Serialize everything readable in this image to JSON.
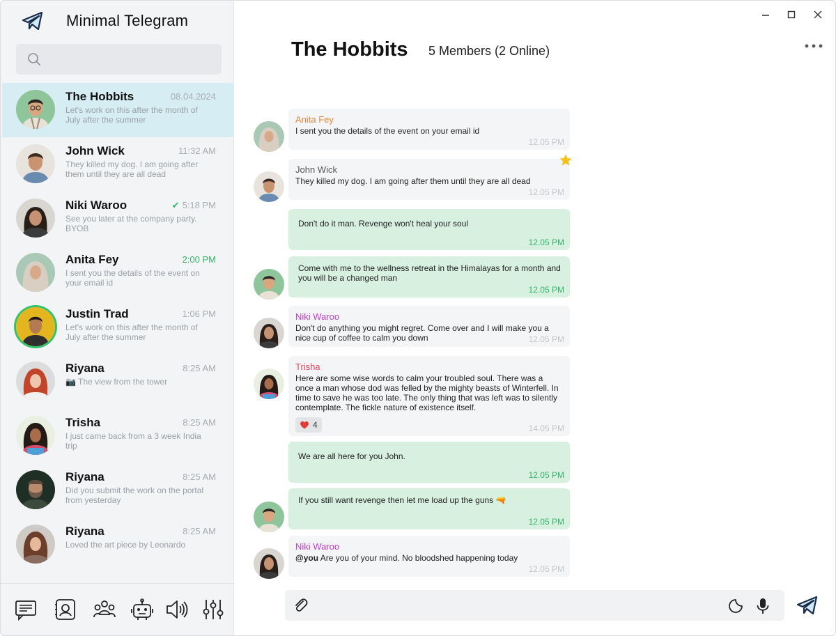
{
  "app": {
    "title": "Minimal Telegram"
  },
  "search": {
    "placeholder": ""
  },
  "chats": [
    {
      "name": "The Hobbits",
      "time": "08.04.2024",
      "preview": "Let's work on this after the month of July after the summer",
      "active": true
    },
    {
      "name": "John Wick",
      "time": "11:32 AM",
      "preview": "They killed my dog. I am going after them until they are all dead"
    },
    {
      "name": "Niki Waroo",
      "time": "5:18 PM",
      "preview": "See you later at the company party. BYOB",
      "read_tick": "✔"
    },
    {
      "name": "Anita Fey",
      "time": "2:00 PM",
      "preview": "I sent you the details of the event on your email id",
      "time_highlight": true
    },
    {
      "name": "Justin Trad",
      "time": "1:06 PM",
      "preview": "Let's work on this after the month of July after the summer",
      "online_ring": true
    },
    {
      "name": "Riyana",
      "time": "8:25 AM",
      "preview": "📷 The view from the tower"
    },
    {
      "name": "Trisha",
      "time": "8:25 AM",
      "preview": "I just came back from a 3 week India trip"
    },
    {
      "name": "Riyana",
      "time": "8:25 AM",
      "preview": "Did you submit the work on the portal from yesterday"
    },
    {
      "name": "Riyana",
      "time": "8:25 AM",
      "preview": "Loved the art piece by Leonardo"
    }
  ],
  "bottom_nav": [
    {
      "icon": "chats-icon"
    },
    {
      "icon": "contacts-icon"
    },
    {
      "icon": "groups-icon"
    },
    {
      "icon": "bot-icon"
    },
    {
      "icon": "speaker-icon"
    },
    {
      "icon": "settings-sliders-icon"
    }
  ],
  "header": {
    "title": "The Hobbits",
    "members": "5 Members (2 Online)"
  },
  "messages": [
    {
      "sender": "Anita Fey",
      "sender_color": "#e8873a",
      "text": "I sent you the details of the event on your email id",
      "time": "12.05 PM",
      "direction": "in"
    },
    {
      "sender": "John Wick",
      "sender_color": "#555555",
      "text": "They killed my dog. I am going after them until they are all dead",
      "time": "12.05 PM",
      "direction": "in",
      "starred": true
    },
    {
      "text": "Don't do it man. Revenge won't heal your soul",
      "time": "12.05 PM",
      "direction": "out"
    },
    {
      "text": "Come with me to the wellness retreat in the Himalayas for a month and you will be a changed man",
      "time": "12.05 PM",
      "direction": "out"
    },
    {
      "sender": "Niki Waroo",
      "sender_color": "#c53bd0",
      "text": "Don't do anything you might regret. Come over and I will make you a nice cup of coffee to calm you down",
      "time": "12.05 PM",
      "direction": "in"
    },
    {
      "sender": "Trisha",
      "sender_color": "#e0455e",
      "text": "Here are some wise words to calm your troubled soul. There was a once a man whose dod was felled by the mighty beasts of Winterfell. In time to save he was too late. The only thing that was left was to silently contemplate. The fickle nature of existence itself.",
      "time": "14.05 PM",
      "direction": "in",
      "reaction": {
        "emoji": "heart",
        "count": "4"
      }
    },
    {
      "text": "We are all here for you John.",
      "time": "12.05 PM",
      "direction": "out"
    },
    {
      "text": "If you still want revenge then let me load up the guns 🔫",
      "time": "12.05 PM",
      "direction": "out"
    },
    {
      "sender": "Niki Waroo",
      "sender_color": "#c53bd0",
      "mention": "@you",
      "text": "Are you of your mind. No bloodshed happening today",
      "time": "12.05 PM",
      "direction": "in"
    }
  ],
  "composer": {
    "placeholder": ""
  },
  "colors": {
    "accent": "#35b36a",
    "active_chat": "#d6eef3",
    "outgoing_bubble": "#d7f0e0",
    "incoming_bubble": "#f4f5f6",
    "brand": "#1d6fb8"
  }
}
